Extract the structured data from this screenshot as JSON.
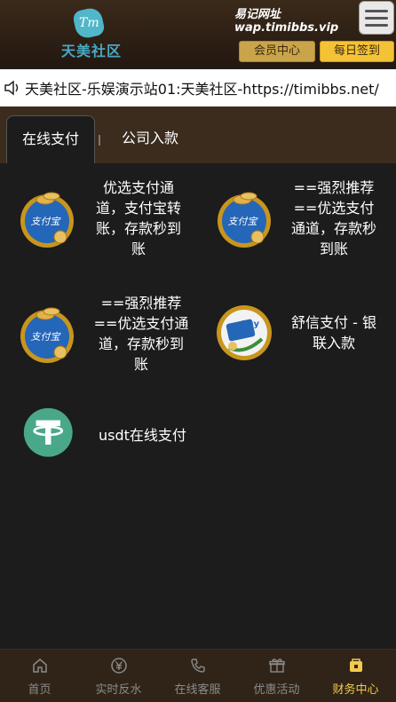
{
  "header": {
    "logo_mark": "Tm",
    "logo_text": "天美社区",
    "site_label": "易记网址",
    "site_url": "wap.timibbs.vip",
    "member_button": "会员中心",
    "checkin_button": "每日签到",
    "menu_icon": "hamburger-menu-icon"
  },
  "notice": {
    "icon": "speaker-icon",
    "text": "天美社区-乐娱演示站01:天美社区-https://timibbs.net/"
  },
  "tabs": [
    {
      "label": "在线支付",
      "active": true
    },
    {
      "label": "公司入款",
      "active": false
    }
  ],
  "payments": [
    {
      "label": "优选支付通道，支付宝转账，存款秒到账",
      "icon": "alipay-coin-icon"
    },
    {
      "label": "==强烈推荐==优选支付通道，存款秒到账",
      "icon": "alipay-coin-icon"
    },
    {
      "label": "==强烈推荐==优选支付通道，存款秒到账",
      "icon": "alipay-coin-icon"
    },
    {
      "label": "舒信支付 - 银联入款",
      "icon": "pay-card-icon"
    },
    {
      "label": "usdt在线支付",
      "icon": "tether-icon"
    }
  ],
  "bottom_nav": [
    {
      "label": "首页",
      "icon": "home-icon",
      "active": false
    },
    {
      "label": "实时反水",
      "icon": "yen-icon",
      "active": false
    },
    {
      "label": "在线客服",
      "icon": "phone-icon",
      "active": false
    },
    {
      "label": "优惠活动",
      "icon": "gift-icon",
      "active": false
    },
    {
      "label": "财务中心",
      "icon": "wallet-icon",
      "active": true
    }
  ],
  "colors": {
    "header_bg": "#2e2015",
    "accent_gold": "#f4c235",
    "nav_active": "#f2c94c",
    "tether_green": "#4aa88a"
  }
}
